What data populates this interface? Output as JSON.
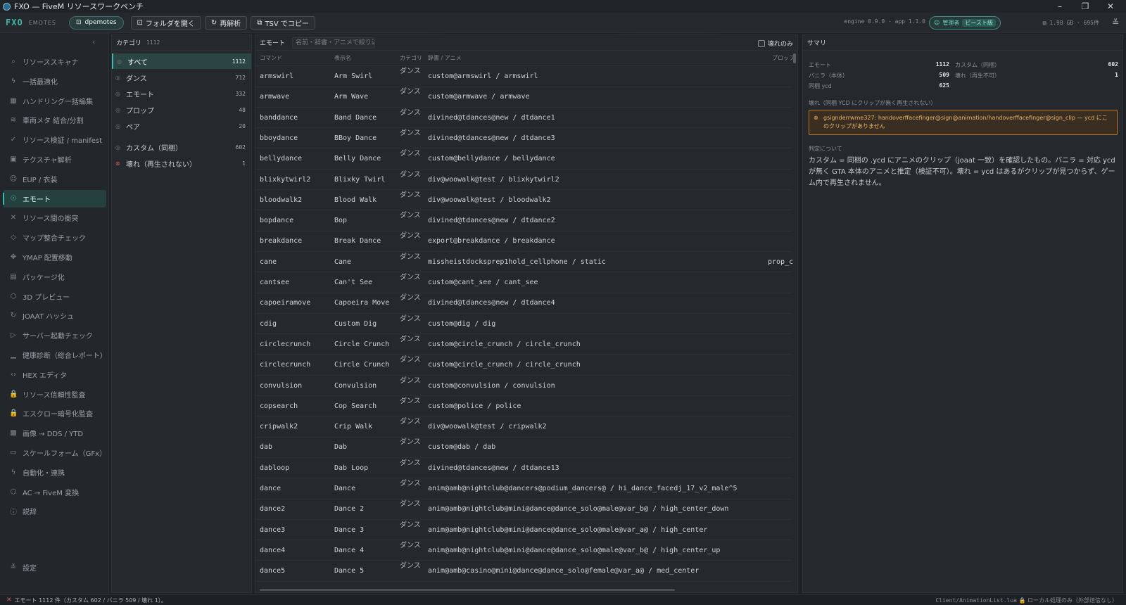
{
  "window": {
    "title": "FXO — FiveM リソースワークベンチ",
    "minimize": "–",
    "maximize": "❐",
    "close": "✕"
  },
  "toolbar": {
    "brand": "FXO",
    "subtitle": "EMOTES",
    "resource_pill": "dpemotes",
    "open_folder": "フォルダを開く",
    "reanalyze": "再解析",
    "copy_tsv": "TSV でコピー",
    "engine": "engine 0.9.0 · app 1.1.0",
    "admin_label": "管理者",
    "admin_tag": "ビースト級",
    "disk": "1.98 GB · 695件"
  },
  "sidebar": {
    "items": [
      {
        "label": "リソーススキャナ",
        "icon": "search-icon",
        "glyph": "⌕"
      },
      {
        "label": "一括最適化",
        "icon": "bolt-icon",
        "glyph": "ϟ"
      },
      {
        "label": "ハンドリング一括編集",
        "icon": "grid-icon",
        "glyph": "▦"
      },
      {
        "label": "車両メタ 結合/分割",
        "icon": "layers-icon",
        "glyph": "≋"
      },
      {
        "label": "リソース検証 / manifest",
        "icon": "check-circle-icon",
        "glyph": "✓"
      },
      {
        "label": "テクスチャ解析",
        "icon": "image-icon",
        "glyph": "▣"
      },
      {
        "label": "EUP / 衣装",
        "icon": "user-icon",
        "glyph": "☺"
      },
      {
        "label": "エモート",
        "icon": "emote-icon",
        "glyph": "☉",
        "active": true
      },
      {
        "label": "リソース間の衝突",
        "icon": "conflict-icon",
        "glyph": "✕"
      },
      {
        "label": "マップ整合チェック",
        "icon": "diamond-icon",
        "glyph": "◇"
      },
      {
        "label": "YMAP 配置移動",
        "icon": "move-icon",
        "glyph": "✥"
      },
      {
        "label": "パッケージ化",
        "icon": "package-icon",
        "glyph": "▤"
      },
      {
        "label": "3D プレビュー",
        "icon": "cube-icon",
        "glyph": "⬡"
      },
      {
        "label": "JOAAT ハッシュ",
        "icon": "hash-icon",
        "glyph": "↻"
      },
      {
        "label": "サーバー起動チェック",
        "icon": "play-icon",
        "glyph": "▷"
      },
      {
        "label": "健康診断（総合レポート）",
        "icon": "bar-chart-icon",
        "glyph": "▁"
      },
      {
        "label": "HEX エディタ",
        "icon": "code-icon",
        "glyph": "‹›"
      },
      {
        "label": "リソース信頼性監査",
        "icon": "lock-icon",
        "glyph": "🔒"
      },
      {
        "label": "エスクロー暗号化監査",
        "icon": "lock-icon",
        "glyph": "🔒"
      },
      {
        "label": "画像 → DDS / YTD",
        "icon": "checker-icon",
        "glyph": "▩"
      },
      {
        "label": "スケールフォーム（GFx）",
        "icon": "monitor-icon",
        "glyph": "▭"
      },
      {
        "label": "自動化・連携",
        "icon": "bolt-icon",
        "glyph": "ϟ"
      },
      {
        "label": "AC → FiveM 変換",
        "icon": "cube-icon",
        "glyph": "⬡"
      },
      {
        "label": "説辞",
        "icon": "info-icon",
        "glyph": "ⓘ"
      }
    ],
    "settings": "設定"
  },
  "categories": {
    "title": "カテゴリ",
    "total": "1112",
    "rows": [
      {
        "label": "すべて",
        "count": "1112",
        "active": true
      },
      {
        "label": "ダンス",
        "count": "712"
      },
      {
        "label": "エモート",
        "count": "332"
      },
      {
        "label": "プロップ",
        "count": "48"
      },
      {
        "label": "ペア",
        "count": "20"
      },
      {
        "label": "カスタム（同梱）",
        "count": "602"
      },
      {
        "label": "壊れ（再生されない）",
        "count": "1",
        "error": true
      }
    ]
  },
  "emotes": {
    "title": "エモート",
    "filter_placeholder": "名前・辞書・アニメで絞り込み",
    "broken_only": "壊れのみ",
    "headers": [
      "コマンド",
      "表示名",
      "カテゴリ",
      "辞書 / アニメ",
      "プロップ"
    ],
    "rows": [
      {
        "cmd": "armswirl",
        "name": "Arm Swirl",
        "cat": "ダンス",
        "dict": "custom@armswirl / armswirl",
        "prop": ""
      },
      {
        "cmd": "armwave",
        "name": "Arm Wave",
        "cat": "ダンス",
        "dict": "custom@armwave / armwave",
        "prop": ""
      },
      {
        "cmd": "banddance",
        "name": "Band Dance",
        "cat": "ダンス",
        "dict": "divined@tdances@new / dtdance1",
        "prop": ""
      },
      {
        "cmd": "bboydance",
        "name": "BBoy Dance",
        "cat": "ダンス",
        "dict": "divined@tdances@new / dtdance3",
        "prop": ""
      },
      {
        "cmd": "bellydance",
        "name": "Belly Dance",
        "cat": "ダンス",
        "dict": "custom@bellydance / bellydance",
        "prop": ""
      },
      {
        "cmd": "blixkytwirl2",
        "name": "Blixky Twirl",
        "cat": "ダンス",
        "dict": "div@woowalk@test / blixkytwirl2",
        "prop": ""
      },
      {
        "cmd": "bloodwalk2",
        "name": "Blood Walk",
        "cat": "ダンス",
        "dict": "div@woowalk@test / bloodwalk2",
        "prop": ""
      },
      {
        "cmd": "bopdance",
        "name": "Bop",
        "cat": "ダンス",
        "dict": "divined@tdances@new / dtdance2",
        "prop": ""
      },
      {
        "cmd": "breakdance",
        "name": "Break Dance",
        "cat": "ダンス",
        "dict": "export@breakdance / breakdance",
        "prop": ""
      },
      {
        "cmd": "cane",
        "name": "Cane",
        "cat": "ダンス",
        "dict": "missheistdocksprep1hold_cellphone / static",
        "prop": "prop_c"
      },
      {
        "cmd": "cantsee",
        "name": "Can't See",
        "cat": "ダンス",
        "dict": "custom@cant_see / cant_see",
        "prop": ""
      },
      {
        "cmd": "capoeiramove",
        "name": "Capoeira Move",
        "cat": "ダンス",
        "dict": "divined@tdances@new / dtdance4",
        "prop": ""
      },
      {
        "cmd": "cdig",
        "name": "Custom Dig",
        "cat": "ダンス",
        "dict": "custom@dig / dig",
        "prop": ""
      },
      {
        "cmd": "circlecrunch",
        "name": "Circle Crunch",
        "cat": "ダンス",
        "dict": "custom@circle_crunch / circle_crunch",
        "prop": ""
      },
      {
        "cmd": "circlecrunch",
        "name": "Circle Crunch",
        "cat": "ダンス",
        "dict": "custom@circle_crunch / circle_crunch",
        "prop": ""
      },
      {
        "cmd": "convulsion",
        "name": "Convulsion",
        "cat": "ダンス",
        "dict": "custom@convulsion / convulsion",
        "prop": ""
      },
      {
        "cmd": "copsearch",
        "name": "Cop Search",
        "cat": "ダンス",
        "dict": "custom@police / police",
        "prop": ""
      },
      {
        "cmd": "cripwalk2",
        "name": "Crip Walk",
        "cat": "ダンス",
        "dict": "div@woowalk@test / cripwalk2",
        "prop": ""
      },
      {
        "cmd": "dab",
        "name": "Dab",
        "cat": "ダンス",
        "dict": "custom@dab / dab",
        "prop": ""
      },
      {
        "cmd": "dabloop",
        "name": "Dab Loop",
        "cat": "ダンス",
        "dict": "divined@tdances@new / dtdance13",
        "prop": ""
      },
      {
        "cmd": "dance",
        "name": "Dance",
        "cat": "ダンス",
        "dict": "anim@amb@nightclub@dancers@podium_dancers@ / hi_dance_facedj_17_v2_male^5",
        "prop": ""
      },
      {
        "cmd": "dance2",
        "name": "Dance 2",
        "cat": "ダンス",
        "dict": "anim@amb@nightclub@mini@dance@dance_solo@male@var_b@ / high_center_down",
        "prop": ""
      },
      {
        "cmd": "dance3",
        "name": "Dance 3",
        "cat": "ダンス",
        "dict": "anim@amb@nightclub@mini@dance@dance_solo@male@var_a@ / high_center",
        "prop": ""
      },
      {
        "cmd": "dance4",
        "name": "Dance 4",
        "cat": "ダンス",
        "dict": "anim@amb@nightclub@mini@dance@dance_solo@male@var_b@ / high_center_up",
        "prop": ""
      },
      {
        "cmd": "dance5",
        "name": "Dance 5",
        "cat": "ダンス",
        "dict": "anim@amb@casino@mini@dance@dance_solo@female@var_a@ / med_center",
        "prop": ""
      }
    ]
  },
  "summary": {
    "title": "サマリ",
    "stats": [
      {
        "label": "エモート",
        "value": "1112"
      },
      {
        "label": "カスタム（同梱）",
        "value": "602"
      },
      {
        "label": "バニラ（本体）",
        "value": "509"
      },
      {
        "label": "壊れ（再生不可）",
        "value": "1"
      },
      {
        "label": "同梱 ycd",
        "value": "625"
      }
    ],
    "broken_title": "壊れ（同梱 YCD にクリップが無く再生されない）",
    "broken_item": "gsignderrwme327: handoverffacefinger@sign@animation/handoverffacefinger@sign_clip — ycd にこのクリップがありません",
    "about_title": "判定について",
    "about_text": "カスタム = 同梱の .ycd にアニメのクリップ（joaat 一致）を確認したもの。バニラ = 対応 ycd が無く GTA 本体のアニメと推定（検証不可）。壊れ = ycd はあるがクリップが見つからず、ゲーム内で再生されません。"
  },
  "status": {
    "left": "エモート 1112 件（カスタム 602 / バニラ 509 / 壊れ 1）。",
    "file": "Client/AnimationList.lua",
    "local": "ローカル処理のみ（外部送信なし）"
  },
  "colors": {
    "accent": "#3fb8a8",
    "error": "#d05555",
    "warning": "#e8a84a",
    "bg": "#1f2227"
  }
}
